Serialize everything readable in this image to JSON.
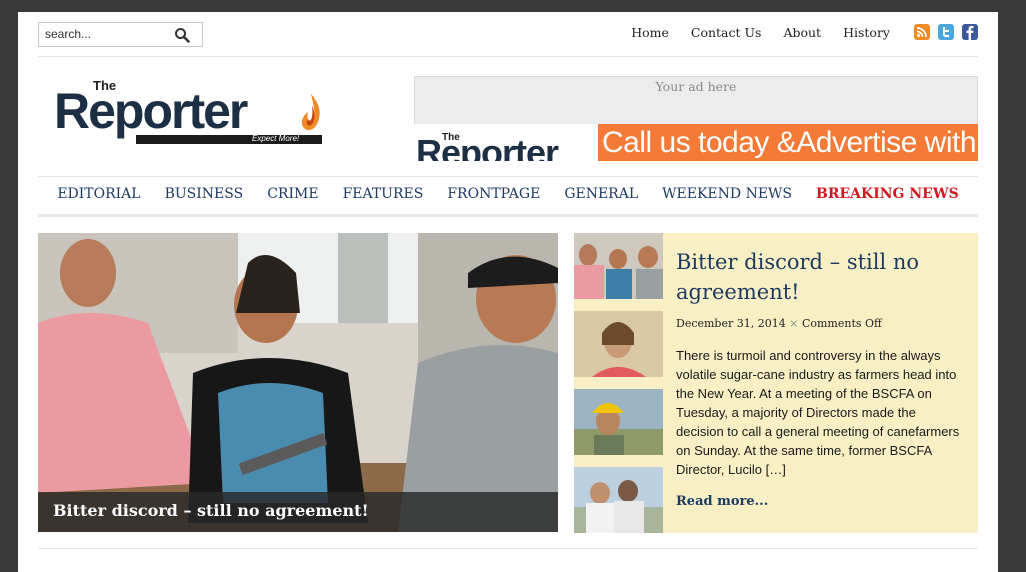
{
  "search": {
    "placeholder": "search..."
  },
  "top_nav": [
    {
      "label": "Home"
    },
    {
      "label": "Contact Us"
    },
    {
      "label": "About"
    },
    {
      "label": "History"
    }
  ],
  "social_icons": [
    "rss-icon",
    "twitter-icon",
    "facebook-icon"
  ],
  "logo": {
    "the": "The",
    "name": "Reporter",
    "tagline": "Expect More!"
  },
  "ad": {
    "placeholder": "Your ad here",
    "banner_the": "The",
    "banner_logo": "Reporter",
    "banner_text": "Call us today &Advertise with us!"
  },
  "main_nav": [
    {
      "label": "EDITORIAL"
    },
    {
      "label": "BUSINESS"
    },
    {
      "label": "CRIME"
    },
    {
      "label": "FEATURES"
    },
    {
      "label": "FRONTPAGE"
    },
    {
      "label": "GENERAL"
    },
    {
      "label": "WEEKEND NEWS"
    },
    {
      "label": "BREAKING NEWS"
    }
  ],
  "featured": {
    "caption": "Bitter discord – still no agreement!"
  },
  "article": {
    "title": "Bitter discord – still no agreement!",
    "date": "December 31, 2014",
    "separator": "×",
    "comments": "Comments Off",
    "excerpt": "There is turmoil and controversy in the always volatile sugar-cane industry as farmers head into the New Year. At a meeting of the BSCFA on Tuesday, a majority of Directors made the decision to call a general meeting of canefarmers on Sunday. At the same time, former BSCFA Director, Lucilo […]",
    "read_more": "Read more..."
  },
  "colors": {
    "nav_text": "#1d3a63",
    "breaking": "#d0191e",
    "panel_bg": "#f8f0c4",
    "banner_orange": "#f47a37"
  }
}
